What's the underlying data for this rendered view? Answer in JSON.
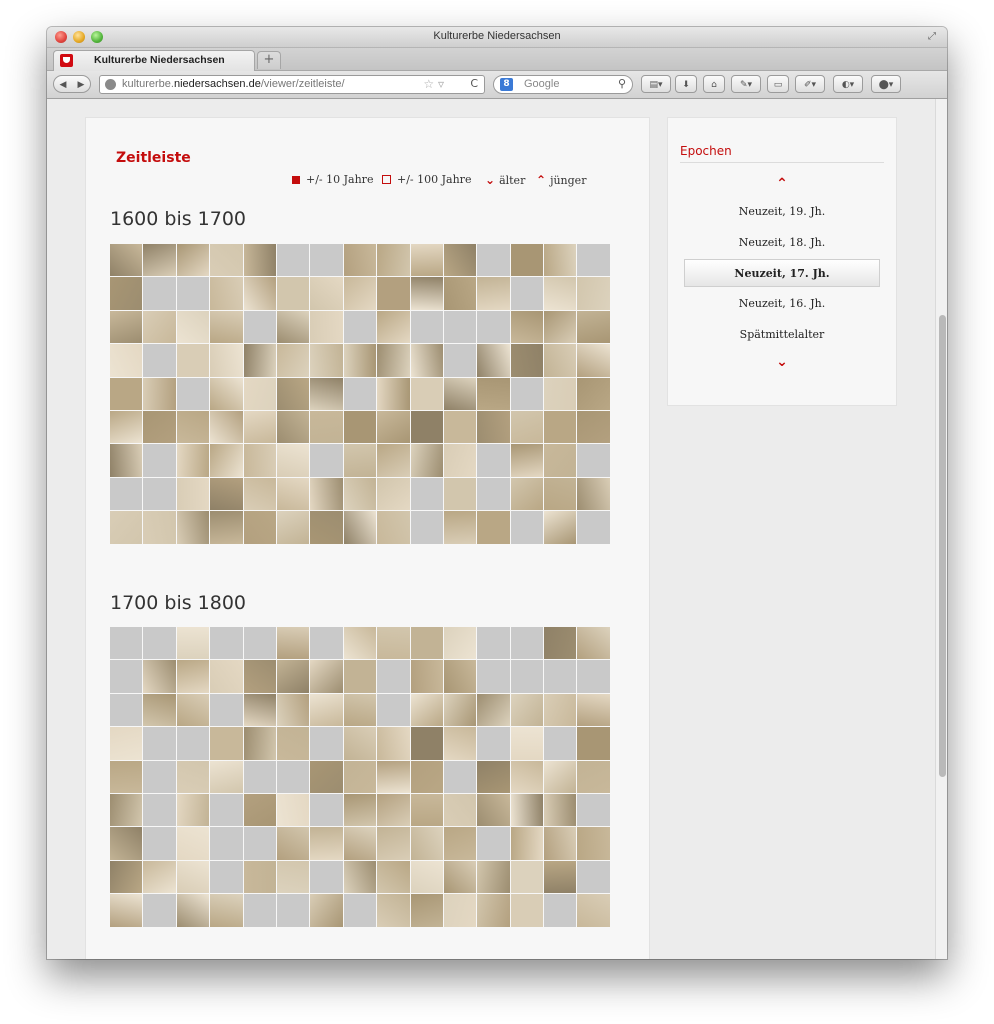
{
  "window": {
    "title": "Kulturerbe Niedersachsen"
  },
  "tab": {
    "title": "Kulturerbe Niedersachsen"
  },
  "navbar": {
    "url_domain_prefix": "kulturerbe.",
    "url_domain_main": "niedersachsen.de",
    "url_path": "/viewer/zeitleiste/",
    "search_placeholder": "Google",
    "search_engine_letter": "8"
  },
  "timeline": {
    "title": "Zeitleiste",
    "controls": {
      "range_10": "+/- 10 Jahre",
      "range_100": "+/- 100 Jahre",
      "older": "älter",
      "younger": "jünger"
    },
    "sections": [
      {
        "label": "1600 bis 1700"
      },
      {
        "label": "1700 bis 1800"
      }
    ]
  },
  "epochs": {
    "title": "Epochen",
    "items": [
      {
        "label": "Neuzeit, 19. Jh.",
        "active": false
      },
      {
        "label": "Neuzeit, 18. Jh.",
        "active": false
      },
      {
        "label": "Neuzeit, 17. Jh.",
        "active": true
      },
      {
        "label": "Neuzeit, 16. Jh.",
        "active": false
      },
      {
        "label": "Spätmittelalter",
        "active": false
      }
    ]
  },
  "colors": {
    "accent": "#c40d0d",
    "tile_empty": "#c9c9c9"
  }
}
